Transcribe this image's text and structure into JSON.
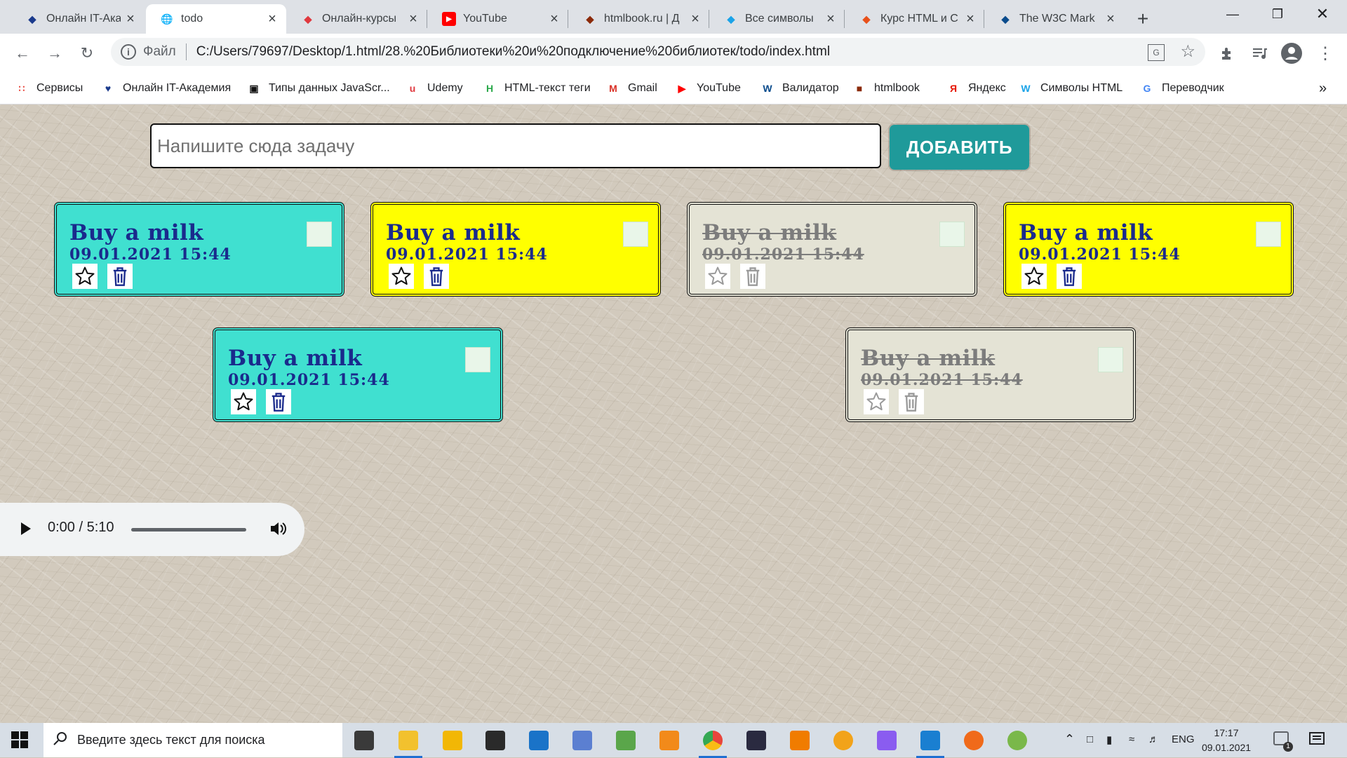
{
  "browser": {
    "tabs": [
      {
        "title": "Онлайн IT-Ака",
        "icon": "it-academy-icon",
        "color": "#1a3a8c",
        "active": false
      },
      {
        "title": "todo",
        "icon": "globe-icon",
        "color": "#5f6368",
        "active": true
      },
      {
        "title": "Онлайн-курсы",
        "icon": "udemy-icon",
        "color": "#e0383e",
        "active": false
      },
      {
        "title": "YouTube",
        "icon": "youtube-icon",
        "color": "#ff0000",
        "active": false
      },
      {
        "title": "htmlbook.ru | Д",
        "icon": "htmlbook-icon",
        "color": "#8b2a0a",
        "active": false
      },
      {
        "title": "Все символы",
        "icon": "w-symbols-icon",
        "color": "#1aa3e8",
        "active": false
      },
      {
        "title": "Курс HTML и С",
        "icon": "fc-icon",
        "color": "#e8501a",
        "active": false
      },
      {
        "title": "The W3C Mark",
        "icon": "w3c-icon",
        "color": "#0a4b8c",
        "active": false
      }
    ],
    "file_label": "Файл",
    "url": "C:/Users/79697/Desktop/1.html/28.%20Библиотеки%20и%20подключение%20библиотек/todo/index.html",
    "bookmarks": [
      {
        "label": "Сервисы",
        "icon": "apps-grid-icon"
      },
      {
        "label": "Онлайн IT-Академия",
        "icon": "it-academy-icon"
      },
      {
        "label": "Типы данных JavaScr...",
        "icon": "js-icon"
      },
      {
        "label": "Udemy",
        "icon": "udemy-icon"
      },
      {
        "label": "HTML-текст теги",
        "icon": "html-h-icon"
      },
      {
        "label": "Gmail",
        "icon": "gmail-icon"
      },
      {
        "label": "YouTube",
        "icon": "youtube-icon"
      },
      {
        "label": "Валидатор",
        "icon": "w3c-icon"
      },
      {
        "label": "htmlbook",
        "icon": "htmlbook-icon"
      },
      {
        "label": "Яндекс",
        "icon": "yandex-icon"
      },
      {
        "label": "Символы HTML",
        "icon": "w-symbols-icon"
      },
      {
        "label": "Переводчик",
        "icon": "translate-icon"
      }
    ],
    "more": "»"
  },
  "app": {
    "input_placeholder": "Напишите сюда задачу",
    "add_label": "ДОБАВИТЬ",
    "cards": [
      {
        "title": "Buy a milk",
        "date": "09.01.2021 15:44",
        "bg": "#40e0d0",
        "done": false
      },
      {
        "title": "Buy a milk",
        "date": "09.01.2021 15:44",
        "bg": "#ffff00",
        "done": false
      },
      {
        "title": "Buy a milk",
        "date": "09.01.2021 15:44",
        "bg": "#e4e3d5",
        "done": true
      },
      {
        "title": "Buy a milk",
        "date": "09.01.2021 15:44",
        "bg": "#ffff00",
        "done": false
      },
      {
        "title": "Buy a milk",
        "date": "09.01.2021 15:44",
        "bg": "#40e0d0",
        "done": false
      },
      {
        "title": "Buy a milk",
        "date": "09.01.2021 15:44",
        "bg": "#e4e3d5",
        "done": true
      }
    ],
    "audio": {
      "time": "0:00 / 5:10",
      "progress": 0
    }
  },
  "taskbar": {
    "search_placeholder": "Введите здесь текст для поиска",
    "apps": [
      {
        "name": "task-view-icon",
        "color": "#3a3a3a"
      },
      {
        "name": "file-explorer-icon",
        "color": "#f2c12e"
      },
      {
        "name": "autocad-icon",
        "color": "#f2b705"
      },
      {
        "name": "store-icon",
        "color": "#2a2a2a"
      },
      {
        "name": "mail-icon",
        "color": "#1a73c8"
      },
      {
        "name": "m-app-icon",
        "color": "#5b7fd1"
      },
      {
        "name": "image-app-icon",
        "color": "#5aa64a"
      },
      {
        "name": "sublime-icon",
        "color": "#f28a1a"
      },
      {
        "name": "chrome-icon",
        "color": "#e8453c"
      },
      {
        "name": "photo-icon",
        "color": "#2a2a40"
      },
      {
        "name": "vlc-icon",
        "color": "#f07c00"
      },
      {
        "name": "edge-icon",
        "color": "#f2a31a"
      },
      {
        "name": "firefox-dev-icon",
        "color": "#8a5cf0"
      },
      {
        "name": "vscode-icon",
        "color": "#1a7fd1"
      },
      {
        "name": "firefox-icon",
        "color": "#f06a1a"
      },
      {
        "name": "android-icon",
        "color": "#7ab84a"
      }
    ],
    "lang": "ENG",
    "time": "17:17",
    "date": "09.01.2021",
    "notification_count": "1"
  }
}
